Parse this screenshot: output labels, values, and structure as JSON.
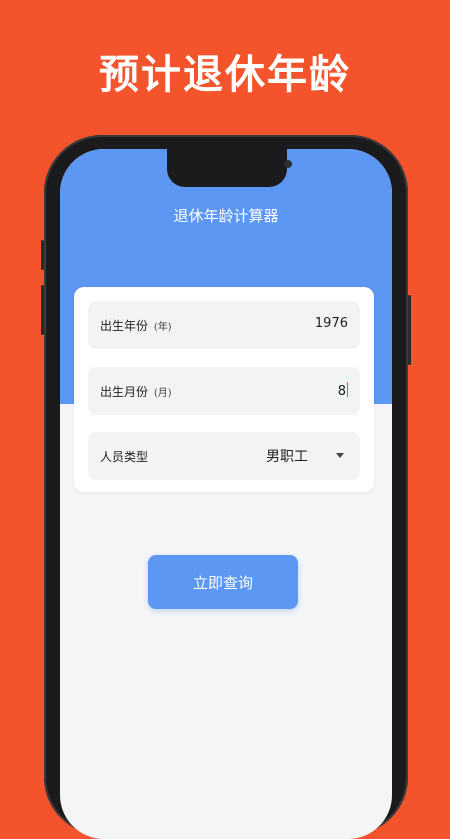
{
  "promo": {
    "title": "预计退休年龄"
  },
  "app": {
    "title": "退休年龄计算器"
  },
  "form": {
    "birth_year": {
      "label": "出生年份",
      "unit": "(年)",
      "value": "1976"
    },
    "birth_month": {
      "label": "出生月份",
      "unit": "(月)",
      "value": "8"
    },
    "person_type": {
      "label": "人员类型",
      "value": "男职工"
    }
  },
  "actions": {
    "query_label": "立即查询"
  },
  "colors": {
    "background": "#f4542c",
    "accent": "#5b97f3",
    "screen": "#f4f5f7"
  }
}
